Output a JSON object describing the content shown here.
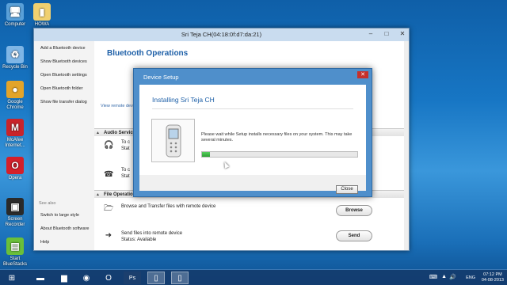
{
  "desktop": {
    "icons": [
      {
        "label": "Computer",
        "icon": "computer-icon",
        "glyph": "🖥",
        "color": "#5aa0d8"
      },
      {
        "label": "Recycle Bin",
        "icon": "recycle-bin-icon",
        "glyph": "♻",
        "color": "#7fb6e6"
      },
      {
        "label": "Google Chrome",
        "icon": "chrome-icon",
        "glyph": "●",
        "color": "#e2a42a"
      },
      {
        "label": "McAfee Internet...",
        "icon": "mcafee-icon",
        "glyph": "M",
        "color": "#c8242b"
      },
      {
        "label": "Opera",
        "icon": "opera-icon",
        "glyph": "O",
        "color": "#d4202a"
      },
      {
        "label": "Screen Recorder",
        "icon": "screen-recorder-icon",
        "glyph": "▣",
        "color": "#2a2a2a"
      },
      {
        "label": "Start BlueStacks",
        "icon": "bluestacks-icon",
        "glyph": "▤",
        "color": "#6abf3a"
      },
      {
        "label": "HOWA",
        "icon": "folder-icon",
        "glyph": "▮",
        "color": "#f0d070"
      }
    ]
  },
  "main_window": {
    "title": "Sri Teja CH(04:18:0f:d7:da:21)",
    "controls": {
      "minimize": "–",
      "maximize": "□",
      "close": "✕"
    },
    "sidebar": {
      "items": [
        "Add a Bluetooth device",
        "Show Bluetooth devices",
        "Open Bluetooth settings",
        "Open Bluetooth folder",
        "Show file transfer dialog"
      ],
      "see_also_label": "See also",
      "see_also_items": [
        "Switch to large style",
        "About Bluetooth software",
        "Help"
      ]
    },
    "heading": "Bluetooth Operations",
    "remote_link": "View remote devi",
    "audio_section": {
      "title": "Audio Service",
      "rows": [
        {
          "line1": "To c",
          "line2": "Stat"
        },
        {
          "line1": "To c",
          "line2": "Stat"
        }
      ]
    },
    "file_section": {
      "title": "File Operation",
      "rows": [
        {
          "text": "Browse and Transfer files with remote device",
          "button": "Browse"
        },
        {
          "text": "Send files into remote device",
          "status": "Status:  Available",
          "button": "Send"
        }
      ]
    }
  },
  "dialog": {
    "title": "Device Setup",
    "close_glyph": "✕",
    "heading": "Installing Sri Teja CH",
    "message": "Please wait while Setup installs necessary files on your system. This may take several minutes.",
    "progress_percent": 5,
    "close_button": "Close"
  },
  "taskbar": {
    "items": [
      {
        "icon": "start-icon",
        "glyph": "⊞"
      },
      {
        "icon": "file-explorer-icon",
        "glyph": "▬"
      },
      {
        "icon": "folder-icon",
        "glyph": "▆"
      },
      {
        "icon": "chrome-icon",
        "glyph": "◉"
      },
      {
        "icon": "opera-icon",
        "glyph": "O"
      },
      {
        "icon": "photoshop-icon",
        "glyph": "Ps"
      },
      {
        "icon": "bluetooth-window-icon",
        "glyph": "▯"
      },
      {
        "icon": "phone-icon",
        "glyph": "▯"
      }
    ],
    "tray": {
      "language": "ENG",
      "time": "07:12 PM",
      "date": "04-08-2013"
    }
  },
  "colors": {
    "accent_blue": "#1d5fa7",
    "dialog_frame": "#4f8fcb",
    "progress_green": "#2d9f34",
    "close_red": "#c7302b"
  }
}
